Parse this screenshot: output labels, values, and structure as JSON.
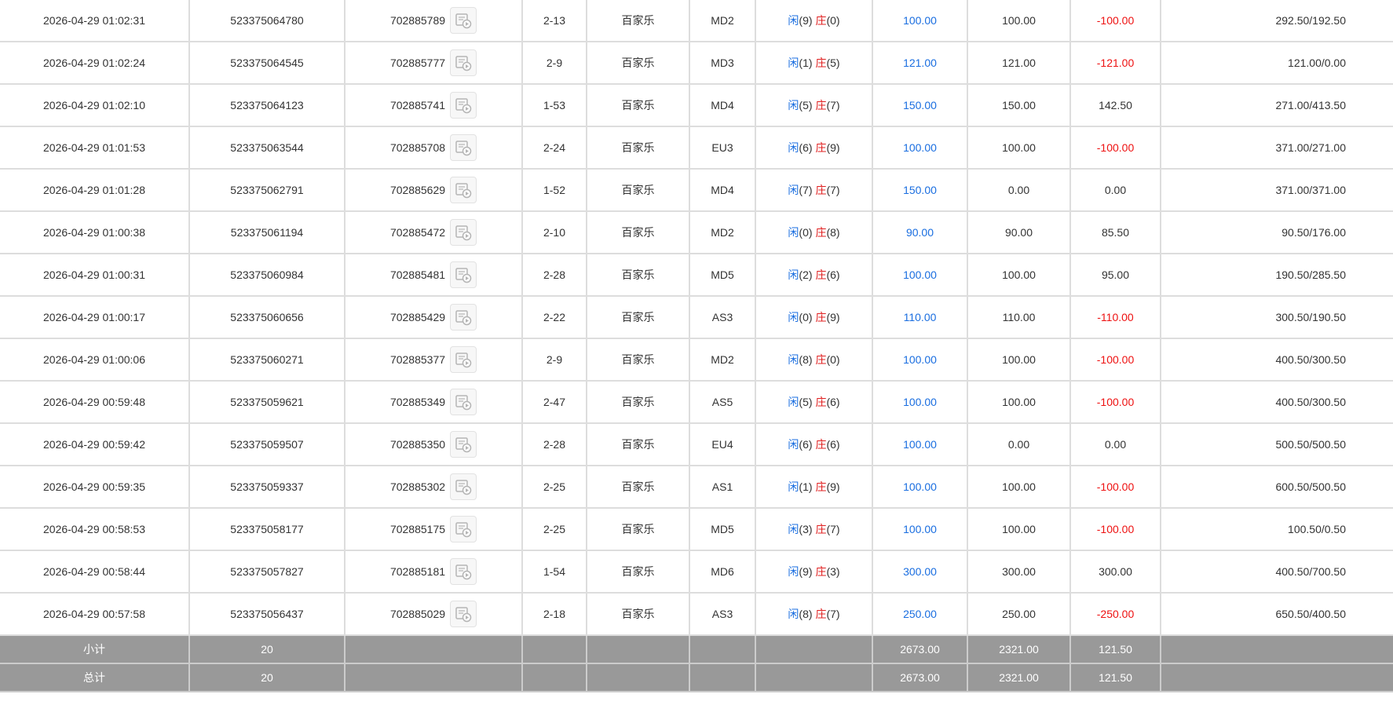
{
  "colors": {
    "player": "#1a6ee0",
    "banker": "#e02020",
    "negative": "#ee1111",
    "footer_bg": "#999999"
  },
  "icons": {
    "replay": "video-replay-icon"
  },
  "rows": [
    {
      "time": "2026-04-29 01:02:31",
      "bet_id": "523375064780",
      "game_no": "702885789",
      "shoe": "2-13",
      "game": "百家乐",
      "table": "MD2",
      "player_label": "闲",
      "player_score": "(9)",
      "banker_label": "庄",
      "banker_score": "(0)",
      "bet": "100.00",
      "valid_bet": "100.00",
      "win_loss": "-100.00",
      "negative": true,
      "balance": "292.50/192.50"
    },
    {
      "time": "2026-04-29 01:02:24",
      "bet_id": "523375064545",
      "game_no": "702885777",
      "shoe": "2-9",
      "game": "百家乐",
      "table": "MD3",
      "player_label": "闲",
      "player_score": "(1)",
      "banker_label": "庄",
      "banker_score": "(5)",
      "bet": "121.00",
      "valid_bet": "121.00",
      "win_loss": "-121.00",
      "negative": true,
      "balance": "121.00/0.00"
    },
    {
      "time": "2026-04-29 01:02:10",
      "bet_id": "523375064123",
      "game_no": "702885741",
      "shoe": "1-53",
      "game": "百家乐",
      "table": "MD4",
      "player_label": "闲",
      "player_score": "(5)",
      "banker_label": "庄",
      "banker_score": "(7)",
      "bet": "150.00",
      "valid_bet": "150.00",
      "win_loss": "142.50",
      "negative": false,
      "balance": "271.00/413.50"
    },
    {
      "time": "2026-04-29 01:01:53",
      "bet_id": "523375063544",
      "game_no": "702885708",
      "shoe": "2-24",
      "game": "百家乐",
      "table": "EU3",
      "player_label": "闲",
      "player_score": "(6)",
      "banker_label": "庄",
      "banker_score": "(9)",
      "bet": "100.00",
      "valid_bet": "100.00",
      "win_loss": "-100.00",
      "negative": true,
      "balance": "371.00/271.00"
    },
    {
      "time": "2026-04-29 01:01:28",
      "bet_id": "523375062791",
      "game_no": "702885629",
      "shoe": "1-52",
      "game": "百家乐",
      "table": "MD4",
      "player_label": "闲",
      "player_score": "(7)",
      "banker_label": "庄",
      "banker_score": "(7)",
      "bet": "150.00",
      "valid_bet": "0.00",
      "win_loss": "0.00",
      "negative": false,
      "balance": "371.00/371.00"
    },
    {
      "time": "2026-04-29 01:00:38",
      "bet_id": "523375061194",
      "game_no": "702885472",
      "shoe": "2-10",
      "game": "百家乐",
      "table": "MD2",
      "player_label": "闲",
      "player_score": "(0)",
      "banker_label": "庄",
      "banker_score": "(8)",
      "bet": "90.00",
      "valid_bet": "90.00",
      "win_loss": "85.50",
      "negative": false,
      "balance": "90.50/176.00"
    },
    {
      "time": "2026-04-29 01:00:31",
      "bet_id": "523375060984",
      "game_no": "702885481",
      "shoe": "2-28",
      "game": "百家乐",
      "table": "MD5",
      "player_label": "闲",
      "player_score": "(2)",
      "banker_label": "庄",
      "banker_score": "(6)",
      "bet": "100.00",
      "valid_bet": "100.00",
      "win_loss": "95.00",
      "negative": false,
      "balance": "190.50/285.50"
    },
    {
      "time": "2026-04-29 01:00:17",
      "bet_id": "523375060656",
      "game_no": "702885429",
      "shoe": "2-22",
      "game": "百家乐",
      "table": "AS3",
      "player_label": "闲",
      "player_score": "(0)",
      "banker_label": "庄",
      "banker_score": "(9)",
      "bet": "110.00",
      "valid_bet": "110.00",
      "win_loss": "-110.00",
      "negative": true,
      "balance": "300.50/190.50"
    },
    {
      "time": "2026-04-29 01:00:06",
      "bet_id": "523375060271",
      "game_no": "702885377",
      "shoe": "2-9",
      "game": "百家乐",
      "table": "MD2",
      "player_label": "闲",
      "player_score": "(8)",
      "banker_label": "庄",
      "banker_score": "(0)",
      "bet": "100.00",
      "valid_bet": "100.00",
      "win_loss": "-100.00",
      "negative": true,
      "balance": "400.50/300.50"
    },
    {
      "time": "2026-04-29 00:59:48",
      "bet_id": "523375059621",
      "game_no": "702885349",
      "shoe": "2-47",
      "game": "百家乐",
      "table": "AS5",
      "player_label": "闲",
      "player_score": "(5)",
      "banker_label": "庄",
      "banker_score": "(6)",
      "bet": "100.00",
      "valid_bet": "100.00",
      "win_loss": "-100.00",
      "negative": true,
      "balance": "400.50/300.50"
    },
    {
      "time": "2026-04-29 00:59:42",
      "bet_id": "523375059507",
      "game_no": "702885350",
      "shoe": "2-28",
      "game": "百家乐",
      "table": "EU4",
      "player_label": "闲",
      "player_score": "(6)",
      "banker_label": "庄",
      "banker_score": "(6)",
      "bet": "100.00",
      "valid_bet": "0.00",
      "win_loss": "0.00",
      "negative": false,
      "balance": "500.50/500.50"
    },
    {
      "time": "2026-04-29 00:59:35",
      "bet_id": "523375059337",
      "game_no": "702885302",
      "shoe": "2-25",
      "game": "百家乐",
      "table": "AS1",
      "player_label": "闲",
      "player_score": "(1)",
      "banker_label": "庄",
      "banker_score": "(9)",
      "bet": "100.00",
      "valid_bet": "100.00",
      "win_loss": "-100.00",
      "negative": true,
      "balance": "600.50/500.50"
    },
    {
      "time": "2026-04-29 00:58:53",
      "bet_id": "523375058177",
      "game_no": "702885175",
      "shoe": "2-25",
      "game": "百家乐",
      "table": "MD5",
      "player_label": "闲",
      "player_score": "(3)",
      "banker_label": "庄",
      "banker_score": "(7)",
      "bet": "100.00",
      "valid_bet": "100.00",
      "win_loss": "-100.00",
      "negative": true,
      "balance": "100.50/0.50"
    },
    {
      "time": "2026-04-29 00:58:44",
      "bet_id": "523375057827",
      "game_no": "702885181",
      "shoe": "1-54",
      "game": "百家乐",
      "table": "MD6",
      "player_label": "闲",
      "player_score": "(9)",
      "banker_label": "庄",
      "banker_score": "(3)",
      "bet": "300.00",
      "valid_bet": "300.00",
      "win_loss": "300.00",
      "negative": false,
      "balance": "400.50/700.50"
    },
    {
      "time": "2026-04-29 00:57:58",
      "bet_id": "523375056437",
      "game_no": "702885029",
      "shoe": "2-18",
      "game": "百家乐",
      "table": "AS3",
      "player_label": "闲",
      "player_score": "(8)",
      "banker_label": "庄",
      "banker_score": "(7)",
      "bet": "250.00",
      "valid_bet": "250.00",
      "win_loss": "-250.00",
      "negative": true,
      "balance": "650.50/400.50"
    }
  ],
  "subtotal": {
    "label": "小计",
    "count": "20",
    "bet": "2673.00",
    "valid_bet": "2321.00",
    "win_loss": "121.50"
  },
  "total": {
    "label": "总计",
    "count": "20",
    "bet": "2673.00",
    "valid_bet": "2321.00",
    "win_loss": "121.50"
  }
}
